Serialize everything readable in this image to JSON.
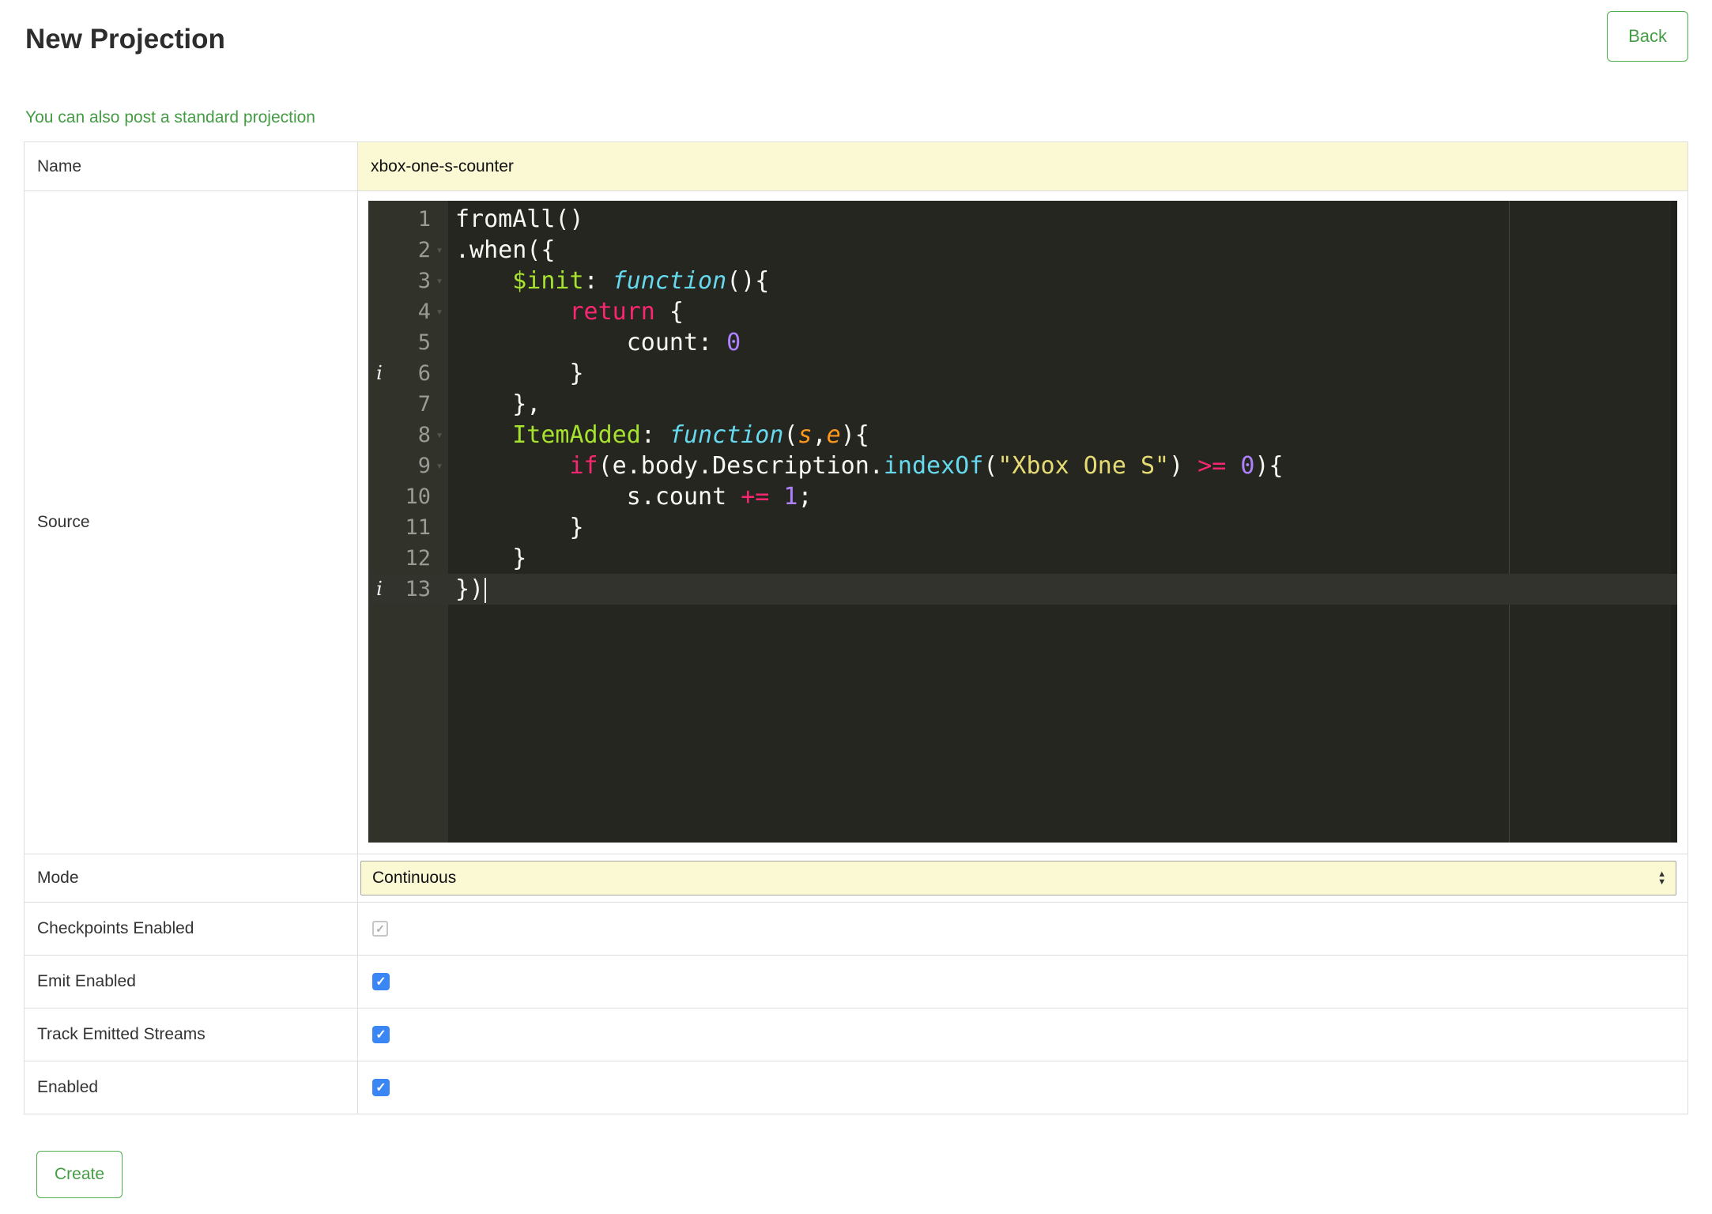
{
  "header": {
    "title": "New Projection",
    "back_label": "Back",
    "link_text": "You can also post a standard projection"
  },
  "form": {
    "name": {
      "label": "Name",
      "value": "xbox-one-s-counter"
    },
    "source": {
      "label": "Source"
    },
    "mode": {
      "label": "Mode",
      "value": "Continuous"
    },
    "checkboxes": [
      {
        "key": "checkpoints",
        "label": "Checkpoints Enabled",
        "checked": true,
        "disabled": true
      },
      {
        "key": "emit",
        "label": "Emit Enabled",
        "checked": true,
        "disabled": false
      },
      {
        "key": "track",
        "label": "Track Emitted Streams",
        "checked": true,
        "disabled": false
      },
      {
        "key": "enabled",
        "label": "Enabled",
        "checked": true,
        "disabled": false
      }
    ],
    "create_label": "Create"
  },
  "icons": {
    "check": "✓",
    "arrow_up": "▲",
    "arrow_down": "▼",
    "fold": "▾",
    "info": "i"
  },
  "colors": {
    "accent_green": "#449d44",
    "accent_green_border": "#4cae4c",
    "checkbox_blue": "#3a86f4",
    "field_yellow": "#fbf8d4",
    "editor_bg": "#25261f",
    "token_keyword": "#f92672",
    "token_property": "#a6e22e",
    "token_function": "#66d9ef",
    "token_string": "#e6db74",
    "token_number": "#ae81ff",
    "token_arg": "#fd971f"
  },
  "editor": {
    "active_line": 13,
    "info_lines": [
      6,
      13
    ],
    "fold_lines": [
      2,
      3,
      4,
      8,
      9
    ],
    "lines": [
      [
        [
          "fromAll()",
          "plain"
        ]
      ],
      [
        [
          ".when({",
          "plain"
        ]
      ],
      [
        [
          "    ",
          "plain"
        ],
        [
          "$init",
          "prop"
        ],
        [
          ": ",
          "plain"
        ],
        [
          "function",
          "fn"
        ],
        [
          "(){",
          "plain"
        ]
      ],
      [
        [
          "        ",
          "plain"
        ],
        [
          "return",
          "kw"
        ],
        [
          " {",
          "plain"
        ]
      ],
      [
        [
          "            count: ",
          "plain"
        ],
        [
          "0",
          "num"
        ]
      ],
      [
        [
          "        }",
          "plain"
        ]
      ],
      [
        [
          "    },",
          "plain"
        ]
      ],
      [
        [
          "    ",
          "plain"
        ],
        [
          "ItemAdded",
          "prop"
        ],
        [
          ": ",
          "plain"
        ],
        [
          "function",
          "fn"
        ],
        [
          "(",
          "plain"
        ],
        [
          "s",
          "arg"
        ],
        [
          ",",
          "plain"
        ],
        [
          "e",
          "arg"
        ],
        [
          "){",
          "plain"
        ]
      ],
      [
        [
          "        ",
          "plain"
        ],
        [
          "if",
          "kw"
        ],
        [
          "(e.body.Description.",
          "plain"
        ],
        [
          "indexOf",
          "builtin"
        ],
        [
          "(",
          "plain"
        ],
        [
          "\"Xbox One S\"",
          "str"
        ],
        [
          ") ",
          "plain"
        ],
        [
          ">=",
          "kw"
        ],
        [
          " ",
          "plain"
        ],
        [
          "0",
          "num"
        ],
        [
          "){",
          "plain"
        ]
      ],
      [
        [
          "            s.count ",
          "plain"
        ],
        [
          "+=",
          "kw"
        ],
        [
          " ",
          "plain"
        ],
        [
          "1",
          "num"
        ],
        [
          ";",
          "plain"
        ]
      ],
      [
        [
          "        }",
          "plain"
        ]
      ],
      [
        [
          "    }",
          "plain"
        ]
      ],
      [
        [
          "})",
          "plain"
        ]
      ]
    ]
  }
}
